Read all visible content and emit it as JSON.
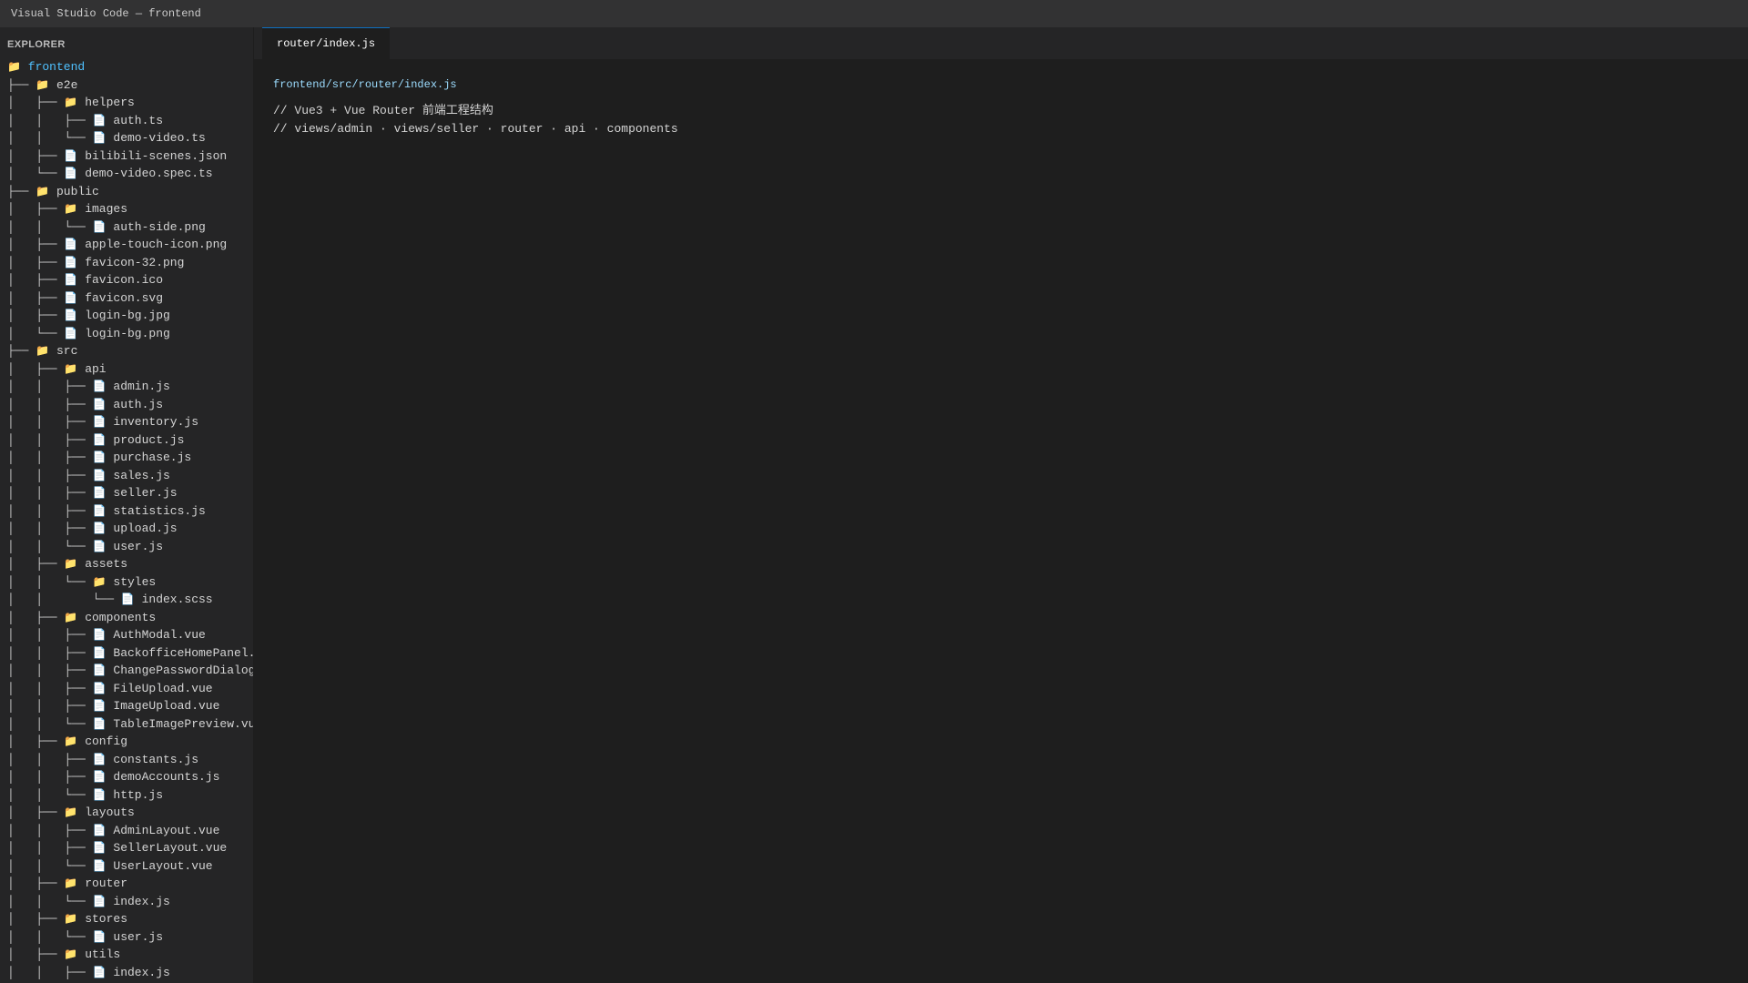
{
  "window": {
    "title": "Visual Studio Code — frontend"
  },
  "sidebar": {
    "header": "EXPLORER",
    "tree": [
      {
        "prefix": "",
        "icon": "folder",
        "label": "frontend",
        "root": true
      },
      {
        "prefix": "├── ",
        "icon": "folder",
        "label": "e2e"
      },
      {
        "prefix": "│   ├── ",
        "icon": "folder",
        "label": "helpers"
      },
      {
        "prefix": "│   │   ├── ",
        "icon": "file",
        "label": "auth.ts"
      },
      {
        "prefix": "│   │   └── ",
        "icon": "file",
        "label": "demo-video.ts"
      },
      {
        "prefix": "│   ├── ",
        "icon": "file",
        "label": "bilibili-scenes.json"
      },
      {
        "prefix": "│   └── ",
        "icon": "file",
        "label": "demo-video.spec.ts"
      },
      {
        "prefix": "├── ",
        "icon": "folder",
        "label": "public"
      },
      {
        "prefix": "│   ├── ",
        "icon": "folder",
        "label": "images"
      },
      {
        "prefix": "│   │   └── ",
        "icon": "file",
        "label": "auth-side.png"
      },
      {
        "prefix": "│   ├── ",
        "icon": "file",
        "label": "apple-touch-icon.png"
      },
      {
        "prefix": "│   ├── ",
        "icon": "file",
        "label": "favicon-32.png"
      },
      {
        "prefix": "│   ├── ",
        "icon": "file",
        "label": "favicon.ico"
      },
      {
        "prefix": "│   ├── ",
        "icon": "file",
        "label": "favicon.svg"
      },
      {
        "prefix": "│   ├── ",
        "icon": "file",
        "label": "login-bg.jpg"
      },
      {
        "prefix": "│   └── ",
        "icon": "file",
        "label": "login-bg.png"
      },
      {
        "prefix": "├── ",
        "icon": "folder",
        "label": "src"
      },
      {
        "prefix": "│   ├── ",
        "icon": "folder",
        "label": "api"
      },
      {
        "prefix": "│   │   ├── ",
        "icon": "file",
        "label": "admin.js"
      },
      {
        "prefix": "│   │   ├── ",
        "icon": "file",
        "label": "auth.js"
      },
      {
        "prefix": "│   │   ├── ",
        "icon": "file",
        "label": "inventory.js"
      },
      {
        "prefix": "│   │   ├── ",
        "icon": "file",
        "label": "product.js"
      },
      {
        "prefix": "│   │   ├── ",
        "icon": "file",
        "label": "purchase.js"
      },
      {
        "prefix": "│   │   ├── ",
        "icon": "file",
        "label": "sales.js"
      },
      {
        "prefix": "│   │   ├── ",
        "icon": "file",
        "label": "seller.js"
      },
      {
        "prefix": "│   │   ├── ",
        "icon": "file",
        "label": "statistics.js"
      },
      {
        "prefix": "│   │   ├── ",
        "icon": "file",
        "label": "upload.js"
      },
      {
        "prefix": "│   │   └── ",
        "icon": "file",
        "label": "user.js"
      },
      {
        "prefix": "│   ├── ",
        "icon": "folder",
        "label": "assets"
      },
      {
        "prefix": "│   │   └── ",
        "icon": "folder",
        "label": "styles"
      },
      {
        "prefix": "│   │       └── ",
        "icon": "file",
        "label": "index.scss"
      },
      {
        "prefix": "│   ├── ",
        "icon": "folder",
        "label": "components"
      },
      {
        "prefix": "│   │   ├── ",
        "icon": "file",
        "label": "AuthModal.vue"
      },
      {
        "prefix": "│   │   ├── ",
        "icon": "file",
        "label": "BackofficeHomePanel."
      },
      {
        "prefix": "│   │   ├── ",
        "icon": "file",
        "label": "ChangePasswordDialog"
      },
      {
        "prefix": "│   │   ├── ",
        "icon": "file",
        "label": "FileUpload.vue"
      },
      {
        "prefix": "│   │   ├── ",
        "icon": "file",
        "label": "ImageUpload.vue"
      },
      {
        "prefix": "│   │   └── ",
        "icon": "file",
        "label": "TableImagePreview.vu"
      },
      {
        "prefix": "│   ├── ",
        "icon": "folder",
        "label": "config"
      },
      {
        "prefix": "│   │   ├── ",
        "icon": "file",
        "label": "constants.js"
      },
      {
        "prefix": "│   │   ├── ",
        "icon": "file",
        "label": "demoAccounts.js"
      },
      {
        "prefix": "│   │   └── ",
        "icon": "file",
        "label": "http.js"
      },
      {
        "prefix": "│   ├── ",
        "icon": "folder",
        "label": "layouts"
      },
      {
        "prefix": "│   │   ├── ",
        "icon": "file",
        "label": "AdminLayout.vue"
      },
      {
        "prefix": "│   │   ├── ",
        "icon": "file",
        "label": "SellerLayout.vue"
      },
      {
        "prefix": "│   │   └── ",
        "icon": "file",
        "label": "UserLayout.vue"
      },
      {
        "prefix": "│   ├── ",
        "icon": "folder",
        "label": "router"
      },
      {
        "prefix": "│   │   └── ",
        "icon": "file",
        "label": "index.js"
      },
      {
        "prefix": "│   ├── ",
        "icon": "folder",
        "label": "stores"
      },
      {
        "prefix": "│   │   └── ",
        "icon": "file",
        "label": "user.js"
      },
      {
        "prefix": "│   ├── ",
        "icon": "folder",
        "label": "utils"
      },
      {
        "prefix": "│   │   ├── ",
        "icon": "file",
        "label": "index.js"
      }
    ]
  },
  "editor": {
    "tab_label": "router/index.js",
    "file_path": "frontend/src/router/index.js",
    "lines": [
      "// Vue3 + Vue Router 前端工程结构",
      "// views/admin · views/seller · router · api · components"
    ]
  },
  "icons": {
    "folder": "📁",
    "file": "📄"
  },
  "colors": {
    "title_bar": "#323233",
    "sidebar_bg": "#252526",
    "editor_bg": "#1e1e1e",
    "root_folder_label": "#4fc1ff",
    "file_path": "#9cdcfe",
    "tab_border": "#0e70c0"
  }
}
